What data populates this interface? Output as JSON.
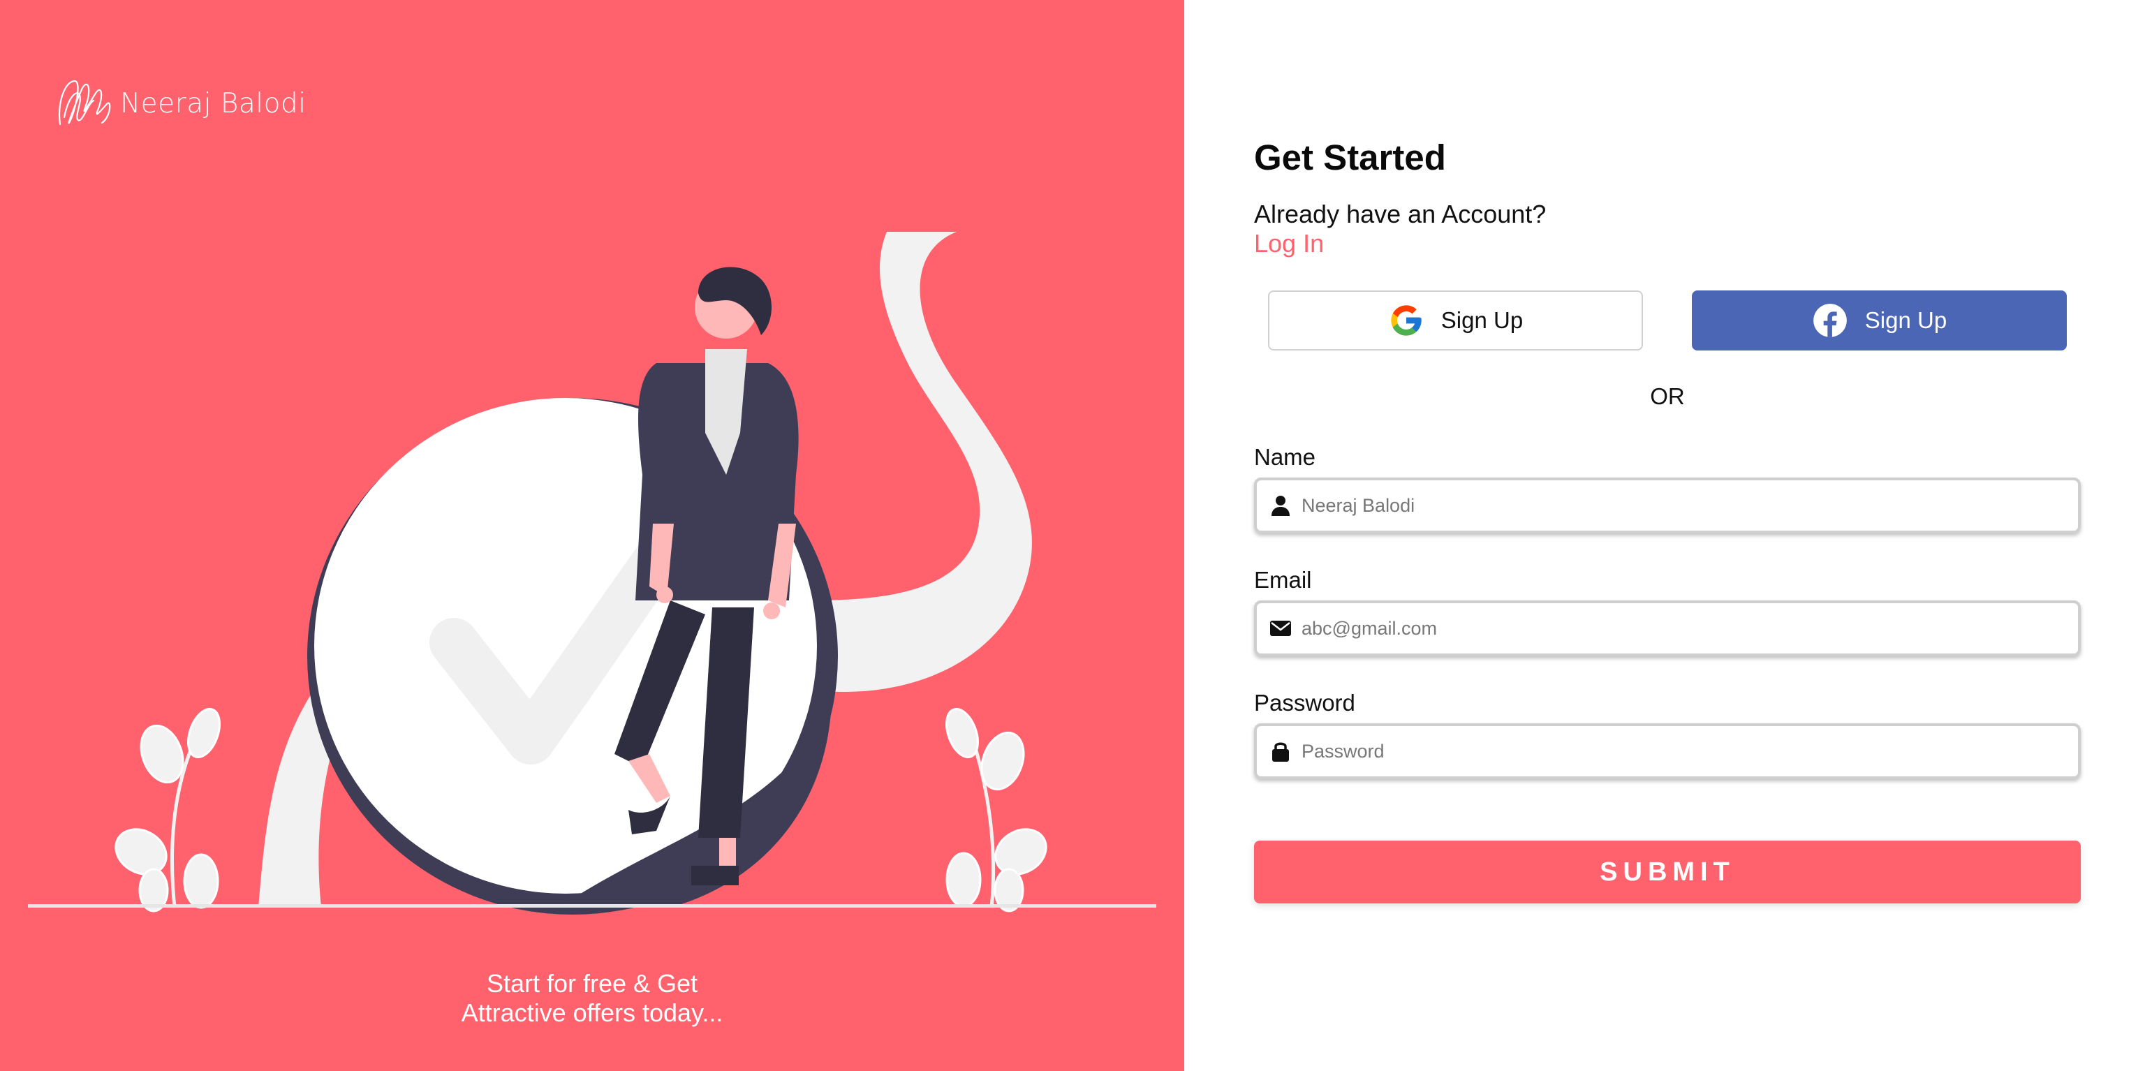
{
  "brand": {
    "name": "Neeraj Balodi",
    "logo_icon": "scribble-logo-icon"
  },
  "left_panel": {
    "background": "#ff616d",
    "tagline_line1": "Start for free & Get",
    "tagline_line2": "Attractive offers today..."
  },
  "form": {
    "title": "Get Started",
    "already_text": "Already have an Account?",
    "login_link": "Log In",
    "google_button": {
      "label": "Sign Up",
      "icon": "google-icon"
    },
    "facebook_button": {
      "label": "Sign Up",
      "icon": "facebook-icon",
      "color": "#4c66b6"
    },
    "or_text": "OR",
    "name": {
      "label": "Name",
      "placeholder": "Neeraj Balodi",
      "icon": "user-icon"
    },
    "email": {
      "label": "Email",
      "placeholder": "abc@gmail.com",
      "icon": "envelope-icon"
    },
    "password": {
      "label": "Password",
      "placeholder": "Password",
      "icon": "lock-icon"
    },
    "submit_label": "SUBMIT"
  },
  "colors": {
    "accent": "#ff616d",
    "facebook": "#4c66b6",
    "illustration_dark": "#3f3d56",
    "illustration_light": "#f2f2f2"
  }
}
